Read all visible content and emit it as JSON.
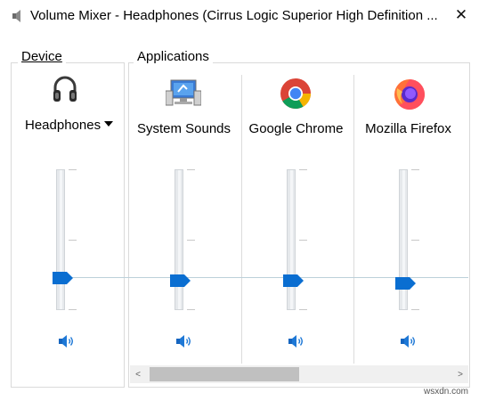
{
  "window": {
    "title": "Volume Mixer - Headphones (Cirrus Logic Superior High Definition ...",
    "close_glyph": "✕"
  },
  "device_group": {
    "label": "Device",
    "device_name": "Headphones",
    "icon": "headphones-icon",
    "level_percent": 24,
    "mute_icon": "speaker-icon"
  },
  "applications_group": {
    "label": "Applications",
    "apps": [
      {
        "name": "System Sounds",
        "icon": "system-sounds-icon",
        "level_percent": 24
      },
      {
        "name": "Google Chrome",
        "icon": "chrome-icon",
        "level_percent": 24
      },
      {
        "name": "Mozilla Firefox",
        "icon": "firefox-icon",
        "level_percent": 20
      }
    ]
  },
  "scrollbar": {
    "left_arrow": "<",
    "right_arrow": ">"
  },
  "watermark": "wsxdn.com",
  "colors": {
    "accent": "#0a6ed1",
    "border": "#dadada",
    "track": "#e6e9ec"
  }
}
